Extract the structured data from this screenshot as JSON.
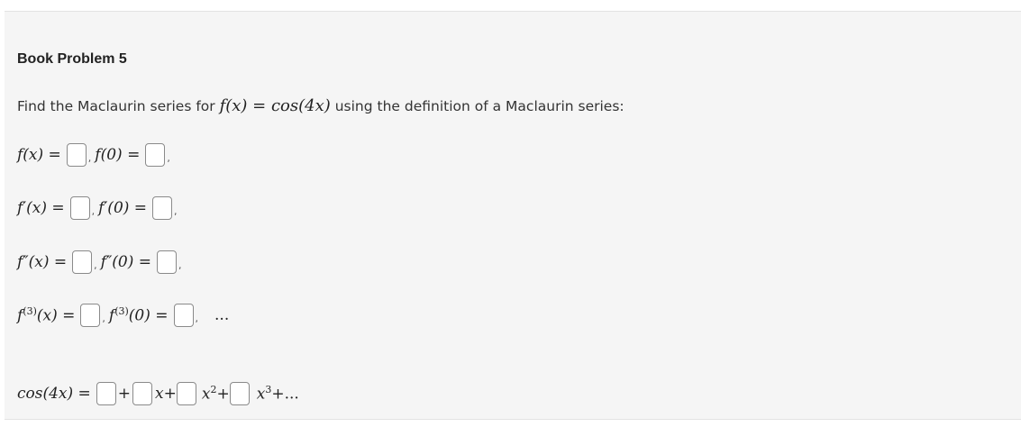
{
  "problem": {
    "title": "Book Problem 5",
    "intro_before": "Find the Maclaurin series for",
    "intro_func": "f(x) = cos(4x)",
    "intro_after": "using the definition of a Maclaurin series:"
  },
  "rows": [
    {
      "lhs": "f(x) =",
      "at_zero": "f(0) ="
    },
    {
      "lhs": "f′(x) =",
      "at_zero": "f′(0) ="
    },
    {
      "lhs": "f″(x) =",
      "at_zero": "f″(0) ="
    },
    {
      "lhs_f": "f",
      "lhs_sup": "(3)",
      "lhs_rest": "(x) =",
      "at_zero_f": "f",
      "at_zero_sup": "(3)",
      "at_zero_rest": "(0) =",
      "trailing": "..."
    }
  ],
  "series": {
    "lhs": "cos(4x) =",
    "plus": "+",
    "x_term": "x+",
    "x2_base": "x",
    "x2_sup": "2",
    "x2_plus": "+",
    "x3_base": "x",
    "x3_sup": "3",
    "x3_tail": "+..."
  },
  "comma": ","
}
